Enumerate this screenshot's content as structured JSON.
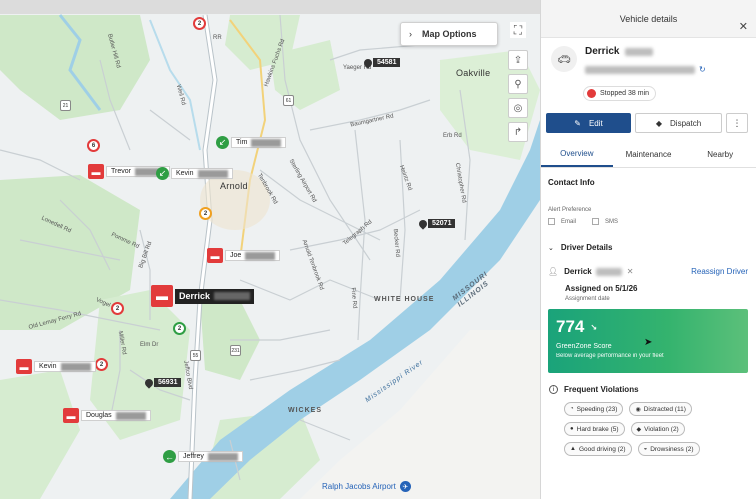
{
  "map": {
    "map_options_label": "Map Options",
    "vehicles": [
      {
        "id": "trevor",
        "label": "Trevor"
      },
      {
        "id": "kevin1",
        "label": "Kevin"
      },
      {
        "id": "tim",
        "label": "Tim"
      },
      {
        "id": "joe",
        "label": "Joe"
      },
      {
        "id": "derrick",
        "label": "Derrick"
      },
      {
        "id": "kevin2",
        "label": "Kevin"
      },
      {
        "id": "douglas",
        "label": "Douglas"
      },
      {
        "id": "jeffrey",
        "label": "Jeffrey"
      }
    ],
    "pins": [
      "54581",
      "52071",
      "56931"
    ],
    "clusters": [
      "2",
      "6",
      "2",
      "2",
      "2",
      "2"
    ],
    "places": {
      "arnold": "Arnold",
      "oakville": "Oakville",
      "white_house": "WHITE HOUSE",
      "wickes": "WICKES",
      "missouri_illinois": "MISSOURI\nILLINOIS",
      "mississippi": "Mississippi River",
      "airport": "Ralph Jacobs Airport"
    },
    "roads": {
      "hawkins_fuchs": "Hawkins Fuchs Rd",
      "baumgartner": "Baumgartner Rd",
      "erb": "Erb Rd",
      "yaeger": "Yaeger Rd",
      "heintz": "Heintz Rd",
      "christopher": "Christopher Rd",
      "becker": "Becker Rd",
      "fine": "Fine Rd",
      "telegraph": "Telegraph Rd",
      "jeffco": "Jeffco Blvd",
      "old_lemay": "Old Lemay Ferry Rd",
      "big_bill": "Big Bill Rd",
      "pomme": "Pomme Rd",
      "lonedell": "Lonedell Rd",
      "vogel": "Vogel Rd",
      "miller": "Miller Rd",
      "elm": "Elm Dr",
      "tenbrook": "Tenbrook Rd",
      "sterling": "Sterling Airport Rd",
      "arnold_tenbrook": "Arnold Tenbrook Rd",
      "weil": "Weil Rd",
      "butler_hill": "Butler Hill Rd",
      "rr": "RR",
      "i55": "55",
      "r61": "61",
      "r231": "231",
      "r21": "21"
    }
  },
  "panel": {
    "header_title": "Vehicle details",
    "vehicle_name": "Derrick",
    "status": "Stopped 38 min",
    "edit_label": "Edit",
    "dispatch_label": "Dispatch",
    "more_label": "⋮",
    "tabs": [
      "Overview",
      "Maintenance",
      "Nearby"
    ],
    "contact_info_title": "Contact Info",
    "alert_preference_label": "Alert Preference",
    "alert_options": [
      "Email",
      "SMS"
    ],
    "driver_details_title": "Driver Details",
    "driver_name": "Derrick",
    "reassign_label": "Reassign Driver",
    "assigned_on": "Assigned on 5/1/26",
    "assignment_date_label": "Assignment date",
    "score": {
      "value": "774",
      "name": "GreenZone Score",
      "subtitle": "Below average performance in your fleet"
    },
    "frequent_violations_title": "Frequent Violations",
    "violations": [
      {
        "label": "Speeding (23)",
        "icon": "speedometer-icon",
        "glyph": "◔"
      },
      {
        "label": "Distracted (11)",
        "icon": "eye-icon",
        "glyph": "◉"
      },
      {
        "label": "Hard brake (5)",
        "icon": "brake-icon",
        "glyph": "●"
      },
      {
        "label": "Violation (2)",
        "icon": "warning-icon",
        "glyph": "◆"
      },
      {
        "label": "Good driving (2)",
        "icon": "thumbs-up-icon",
        "glyph": "▲"
      },
      {
        "label": "Drowsiness (2)",
        "icon": "drowsy-icon",
        "glyph": "◒"
      }
    ],
    "colors": {
      "accent": "#1f4e8c",
      "status_red": "#e23b3b",
      "score_green": "#34b36e"
    }
  }
}
